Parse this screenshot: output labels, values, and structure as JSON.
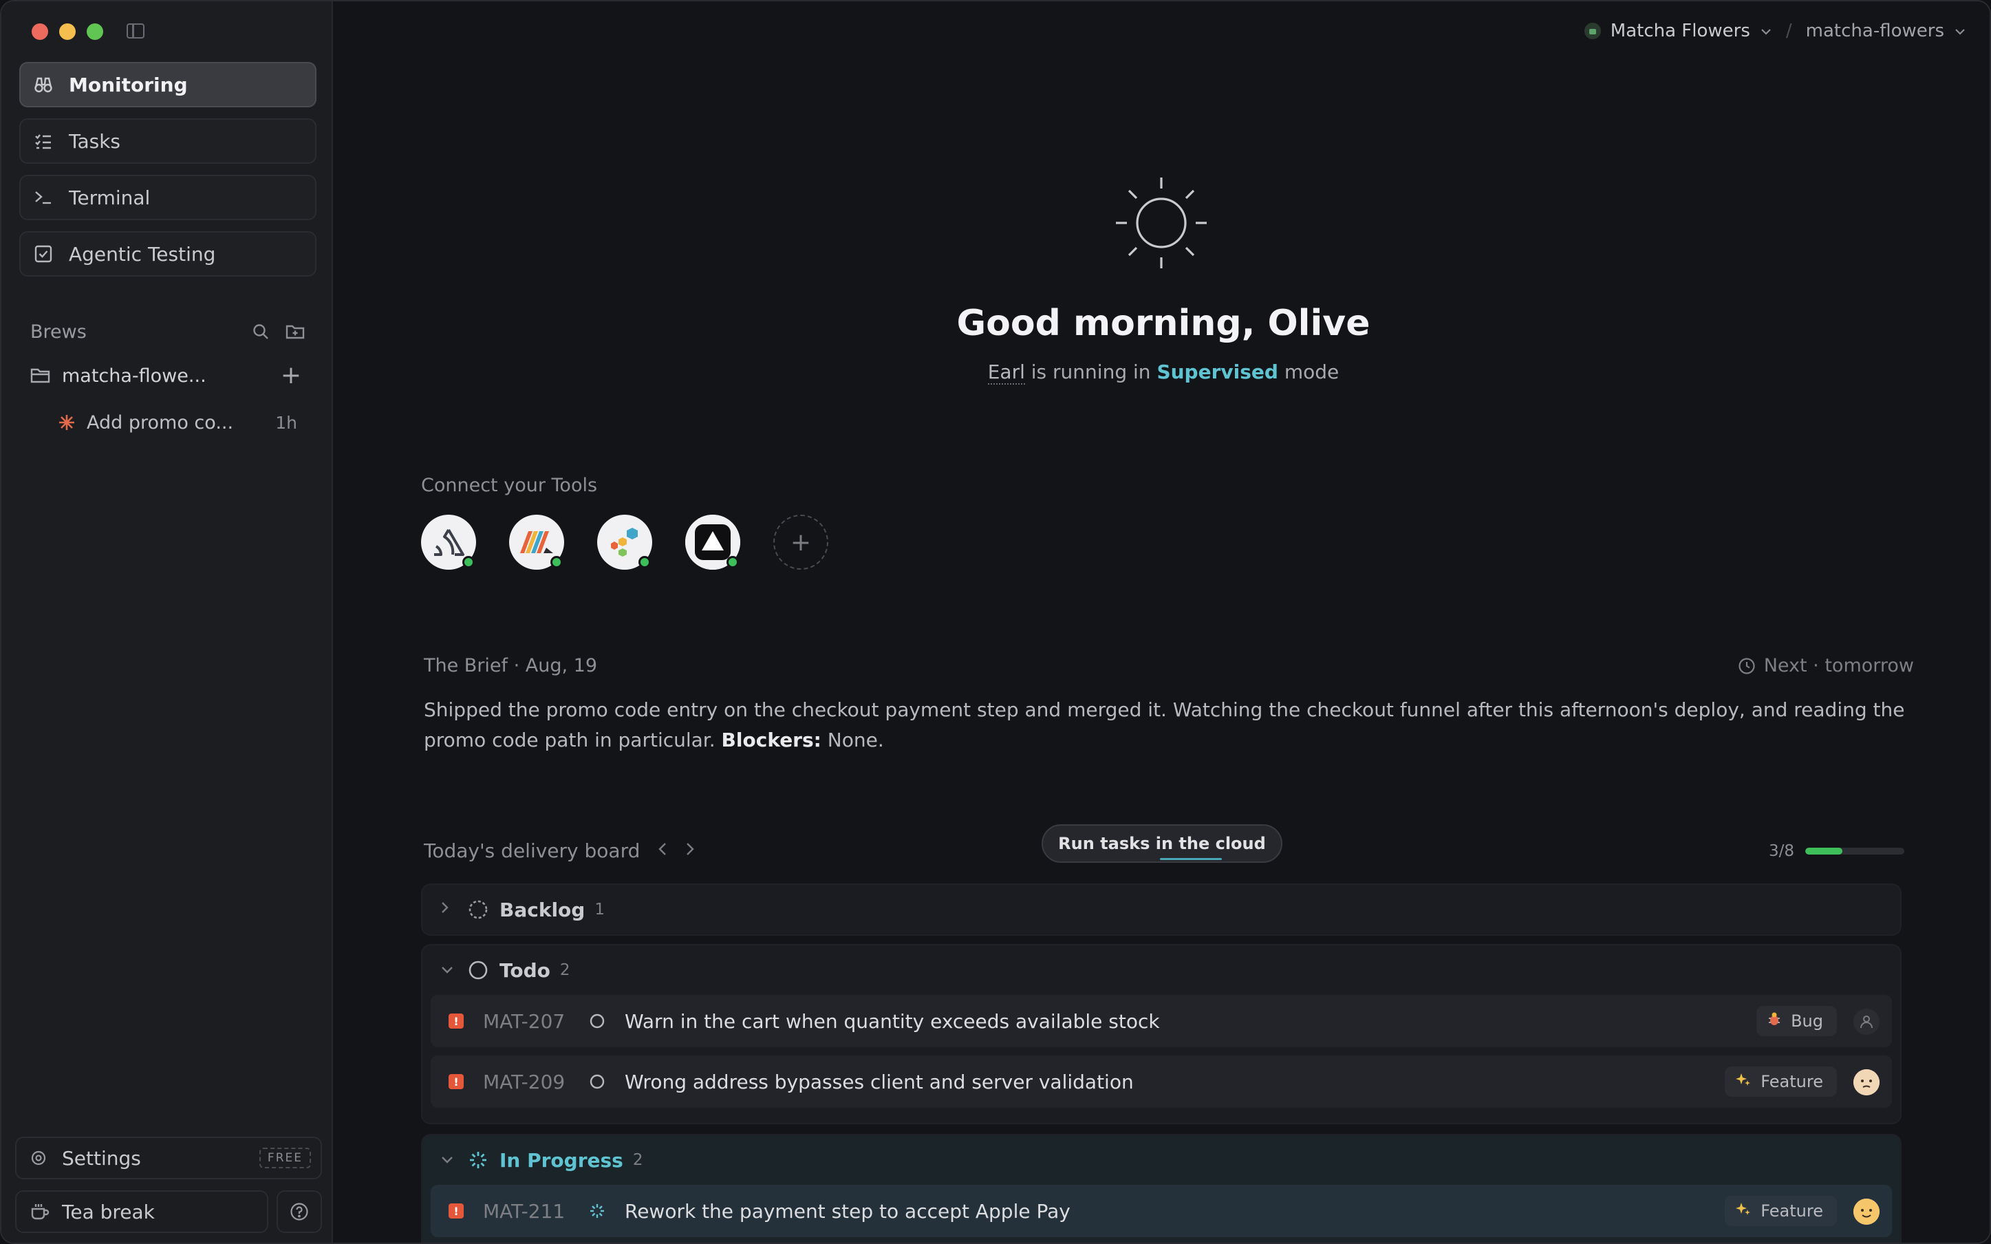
{
  "sidebar": {
    "nav": [
      {
        "label": "Monitoring",
        "icon": "binoculars-icon",
        "active": true
      },
      {
        "label": "Tasks",
        "icon": "checklist-icon",
        "active": false
      },
      {
        "label": "Terminal",
        "icon": "terminal-icon",
        "active": false
      },
      {
        "label": "Agentic Testing",
        "icon": "checkbox-icon",
        "active": false
      }
    ],
    "brews_label": "Brews",
    "folder": {
      "label": "matcha-flowe...",
      "icon": "folder-icon"
    },
    "brew_item": {
      "label": "Add promo co...",
      "time": "1h",
      "icon": "asterisk-icon"
    },
    "settings": {
      "label": "Settings",
      "badge": "FREE"
    },
    "tea_break": {
      "label": "Tea break"
    }
  },
  "header": {
    "workspace": "Matcha Flowers",
    "repo": "matcha-flowers",
    "separator": "/"
  },
  "hero": {
    "greeting": "Good morning, Olive",
    "agent": "Earl",
    "running_in": "is running in",
    "mode": "Supervised",
    "mode_suffix": "mode"
  },
  "tools": {
    "title": "Connect your Tools",
    "items": [
      {
        "name": "sentry",
        "connected": true
      },
      {
        "name": "linear-stripes",
        "connected": true
      },
      {
        "name": "hex-honeycomb",
        "connected": true
      },
      {
        "name": "vercel",
        "connected": true
      }
    ]
  },
  "brief": {
    "title": "The Brief · Aug, 19",
    "next": "Next · tomorrow",
    "text": "Shipped the promo code entry on the checkout payment step and merged it. Watching the checkout funnel after this afternoon's deploy, and reading the promo code path in particular.",
    "blockers_label": "Blockers:",
    "blockers_value": "None."
  },
  "board": {
    "title": "Today's delivery board",
    "cloud_button": "Run tasks in the cloud",
    "progress_text": "3/8",
    "progress": 0.375,
    "groups": [
      {
        "name": "Backlog",
        "count": "1",
        "expanded": false
      },
      {
        "name": "Todo",
        "count": "2",
        "expanded": true,
        "rows": [
          {
            "id": "MAT-207",
            "title": "Warn in the cart when quantity exceeds available stock",
            "tag": "Bug",
            "tag_icon": "bug-icon",
            "assignee": "none"
          },
          {
            "id": "MAT-209",
            "title": "Wrong address bypasses client and server validation",
            "tag": "Feature",
            "tag_icon": "sparkles-icon",
            "assignee": "face"
          }
        ]
      },
      {
        "name": "In Progress",
        "count": "2",
        "expanded": true,
        "rows": [
          {
            "id": "MAT-211",
            "title": "Rework the payment step to accept Apple Pay",
            "tag": "Feature",
            "tag_icon": "sparkles-icon",
            "assignee": "face"
          }
        ]
      }
    ]
  },
  "colors": {
    "accent_teal": "#5fc3d2",
    "success_green": "#3fbf5a",
    "priority_red": "#e5573a"
  }
}
